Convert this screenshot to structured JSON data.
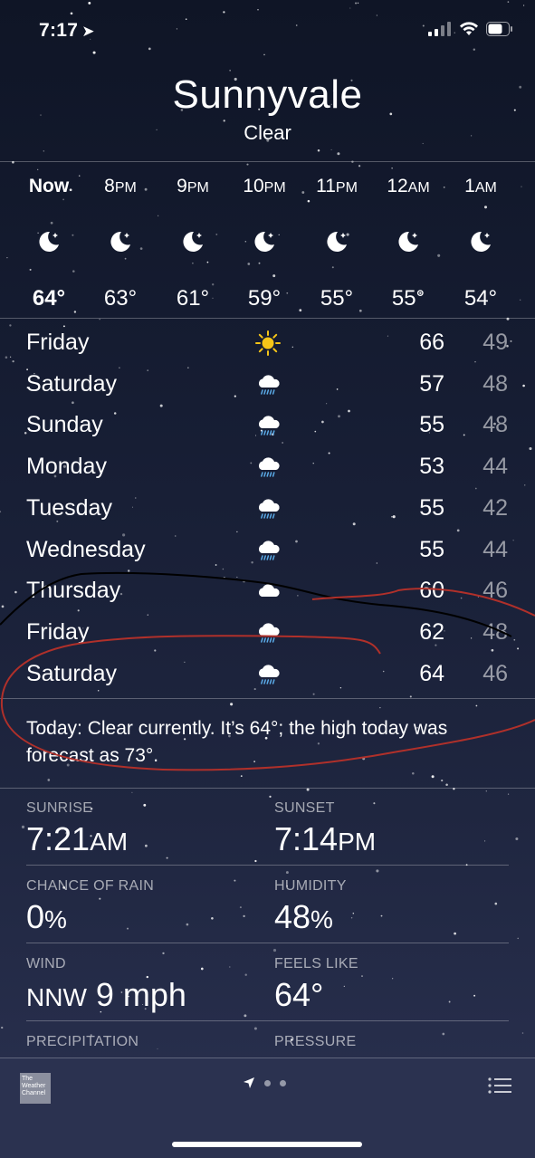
{
  "status_bar": {
    "time": "7:17"
  },
  "header": {
    "city": "Sunnyvale",
    "condition": "Clear"
  },
  "hourly": [
    {
      "time": "Now",
      "ampm": "",
      "icon": "moon-icon",
      "temp": "64°"
    },
    {
      "time": "8",
      "ampm": "PM",
      "icon": "moon-icon",
      "temp": "63°"
    },
    {
      "time": "9",
      "ampm": "PM",
      "icon": "moon-icon",
      "temp": "61°"
    },
    {
      "time": "10",
      "ampm": "PM",
      "icon": "moon-icon",
      "temp": "59°"
    },
    {
      "time": "11",
      "ampm": "PM",
      "icon": "moon-icon",
      "temp": "55°"
    },
    {
      "time": "12",
      "ampm": "AM",
      "icon": "moon-icon",
      "temp": "55°"
    },
    {
      "time": "1",
      "ampm": "AM",
      "icon": "moon-icon",
      "temp": "54°"
    }
  ],
  "daily": [
    {
      "day": "Friday",
      "icon": "sun-icon",
      "high": "66",
      "low": "49"
    },
    {
      "day": "Saturday",
      "icon": "rain-cloud-icon",
      "high": "57",
      "low": "48"
    },
    {
      "day": "Sunday",
      "icon": "rain-cloud-icon",
      "high": "55",
      "low": "48"
    },
    {
      "day": "Monday",
      "icon": "rain-cloud-icon",
      "high": "53",
      "low": "44"
    },
    {
      "day": "Tuesday",
      "icon": "rain-cloud-icon",
      "high": "55",
      "low": "42"
    },
    {
      "day": "Wednesday",
      "icon": "rain-cloud-icon",
      "high": "55",
      "low": "44"
    },
    {
      "day": "Thursday",
      "icon": "cloud-icon",
      "high": "60",
      "low": "46"
    },
    {
      "day": "Friday",
      "icon": "rain-cloud-icon",
      "high": "62",
      "low": "48"
    },
    {
      "day": "Saturday",
      "icon": "rain-cloud-icon",
      "high": "64",
      "low": "46"
    }
  ],
  "summary": "Today: Clear currently. It’s 64°; the high today was forecast as 73°.",
  "details": {
    "sunrise": {
      "label": "SUNRISE",
      "value": "7:21",
      "suffix": "AM"
    },
    "sunset": {
      "label": "SUNSET",
      "value": "7:14",
      "suffix": "PM"
    },
    "chance_of_rain": {
      "label": "CHANCE OF RAIN",
      "value": "0",
      "suffix": "%"
    },
    "humidity": {
      "label": "HUMIDITY",
      "value": "48",
      "suffix": "%"
    },
    "wind": {
      "label": "WIND",
      "prefix": "NNW",
      "value": "9 mph"
    },
    "feels_like": {
      "label": "FEELS LIKE",
      "value": "64°"
    },
    "precipitation": {
      "label": "PRECIPITATION"
    },
    "pressure": {
      "label": "PRESSURE"
    }
  },
  "bottom_bar": {
    "logo_text": "The Weather Channel"
  },
  "colors": {
    "background_top": "#0f1526",
    "background_bottom": "#2a3150",
    "sun": "#f5c518",
    "rain": "#5aa9e6",
    "annotation_black": "#000000",
    "annotation_red": "#b0302a"
  }
}
